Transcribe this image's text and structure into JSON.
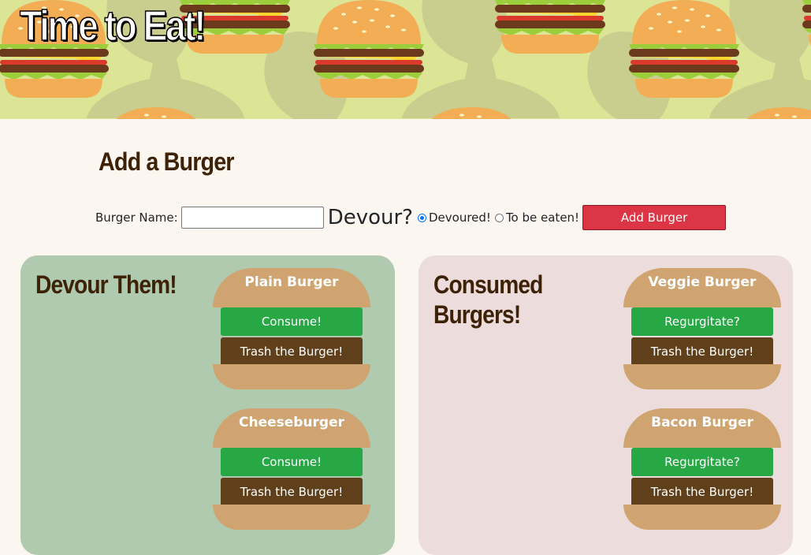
{
  "header": {
    "title": "Time to Eat!"
  },
  "form": {
    "heading": "Add a Burger",
    "name_label": "Burger Name:",
    "name_value": "",
    "devour_question": "Devour?",
    "option_devoured": "Devoured!",
    "option_to_be_eaten": "To be eaten!",
    "selected_option": "Devoured!",
    "submit_label": "Add Burger"
  },
  "devour_panel": {
    "title_line1": "Devour Them!",
    "burgers": [
      {
        "name": "Plain Burger",
        "action": "Consume!",
        "trash": "Trash the Burger!"
      },
      {
        "name": "Cheeseburger",
        "action": "Consume!",
        "trash": "Trash the Burger!"
      }
    ]
  },
  "consumed_panel": {
    "title_line1": "Consumed",
    "title_line2": "Burgers!",
    "burgers": [
      {
        "name": "Veggie Burger",
        "action": "Regurgitate?",
        "trash": "Trash the Burger!"
      },
      {
        "name": "Bacon Burger",
        "action": "Regurgitate?",
        "trash": "Trash the Burger!"
      }
    ]
  },
  "colors": {
    "banner_bg": "#dbe595",
    "page_bg": "#fcf6f0",
    "devour_panel_bg": "#afcaae",
    "consumed_panel_bg": "#eddcdc",
    "bun": "#cfa470",
    "consume_button": "#28a745",
    "trash_button": "#60401b",
    "add_button": "#dc3545"
  }
}
